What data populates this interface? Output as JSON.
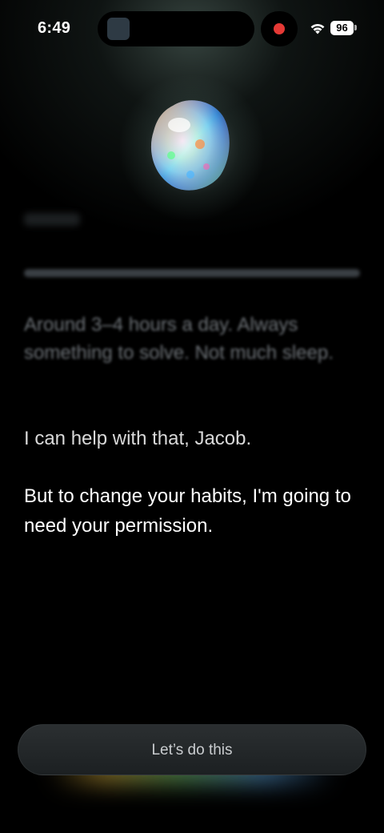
{
  "status_bar": {
    "time": "6:49",
    "battery": "96",
    "icons": [
      "wifi-icon",
      "battery-icon",
      "recording-indicator-icon"
    ]
  },
  "conversation": {
    "user_reply": "Around 3–4 hours a day. Always something to solve. Not much sleep.",
    "assistant_message_1": "I can help with that, Jacob.",
    "assistant_message_2": "But to change your habits, I'm going to need your permission."
  },
  "cta": {
    "label": "Let’s do this"
  },
  "colors": {
    "background": "#000000",
    "recording_dot": "#e53935",
    "faded_text": "#6d7277"
  }
}
